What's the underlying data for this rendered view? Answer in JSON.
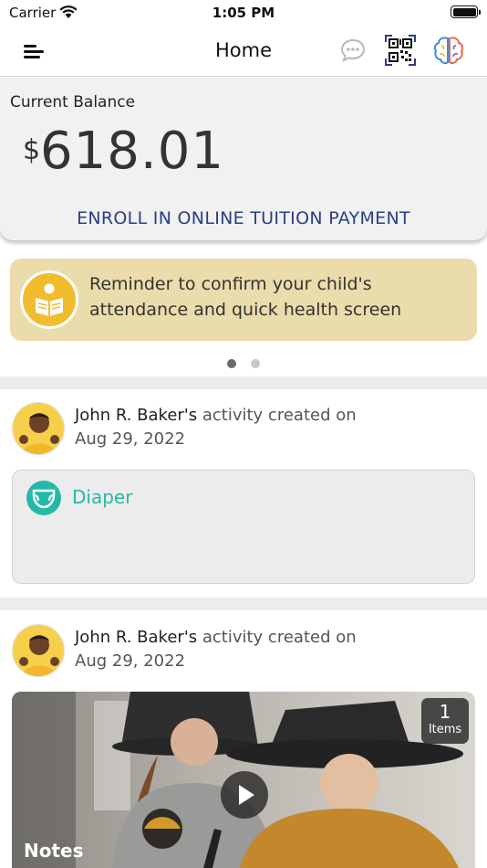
{
  "status_bar": {
    "carrier": "Carrier",
    "time": "1:05 PM"
  },
  "nav": {
    "title": "Home",
    "icons": [
      "menu-icon",
      "chat-icon",
      "qr-code-icon",
      "brain-icon"
    ]
  },
  "balance": {
    "label": "Current Balance",
    "currency": "$",
    "amount": "618.01",
    "enroll_link": "ENROLL IN ONLINE TUITION PAYMENT"
  },
  "reminder": {
    "text": "Reminder to confirm your child's attendance and quick health screen",
    "icon": "reader-icon",
    "color": "#ebdcac"
  },
  "carousel": {
    "pages": 2,
    "active": 1
  },
  "activities": [
    {
      "name": "John R. Baker's",
      "suffix": " activity created on",
      "date": "Aug 29, 2022",
      "card_type": "Diaper",
      "card_icon": "diaper-icon"
    },
    {
      "name": "John R. Baker's",
      "suffix": " activity created on",
      "date": "Aug 29, 2022",
      "card_type": "Notes",
      "items_count": "1",
      "items_label": "Items"
    }
  ],
  "colors": {
    "accent_link": "#2a3e86",
    "diaper_teal": "#23b9a8",
    "reminder_icon": "#f1bc2d"
  }
}
